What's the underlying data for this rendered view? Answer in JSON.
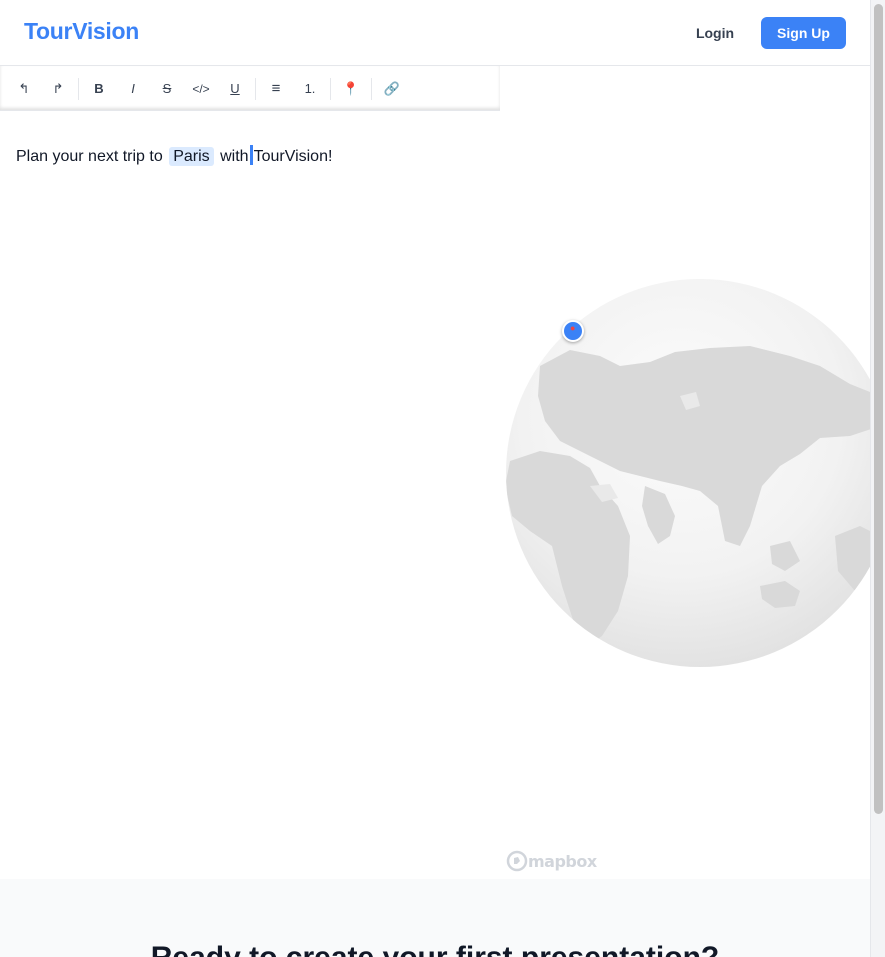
{
  "header": {
    "brand": "TourVision",
    "login_label": "Login",
    "signup_label": "Sign Up"
  },
  "toolbar": {
    "undo": "↰",
    "redo": "↱",
    "bold": "B",
    "italic": "I",
    "strike": "S",
    "code": "</>",
    "underline": "U",
    "bullet_list": "≡",
    "ordered_list": "1.",
    "location": "📍",
    "link": "🔗"
  },
  "editor": {
    "before": "Plan your next trip to",
    "highlight": "Paris",
    "after_1": "with",
    "after_2": "TourVision!"
  },
  "map": {
    "attribution": "mapbox",
    "pin_icon": "map-pin-icon"
  },
  "cta": {
    "title": "Ready to create your first presentation?"
  },
  "colors": {
    "accent": "#3b82f6",
    "highlight": "#dbeafe"
  }
}
